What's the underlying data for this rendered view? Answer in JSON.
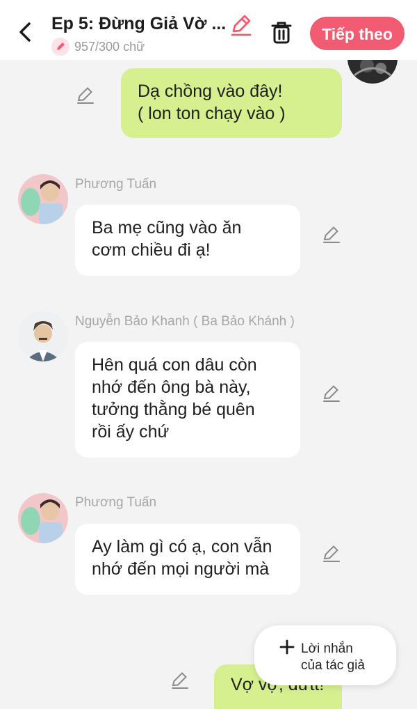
{
  "header": {
    "title": "Ep 5: Đừng Giả Vờ ...",
    "word_count": "957/300 chữ",
    "next_label": "Tiếp theo"
  },
  "messages": [
    {
      "side": "me",
      "text": "Dạ chồng vào đây!\n( lon ton chạy vào )"
    },
    {
      "side": "other",
      "name": "Phương Tuấn",
      "text": "Ba mẹ cũng vào ăn\ncơm chiều đi ạ!"
    },
    {
      "side": "other",
      "name": "Nguyễn Bảo Khanh ( Ba Bảo Khánh )",
      "text": "Hên quá con dâu còn\nnhớ đến ông bà này,\ntưởng thằng bé quên\nrồi ấy chứ"
    },
    {
      "side": "other",
      "name": "Phương Tuấn",
      "text": "Ay làm gì có ạ, con vẫn\nnhớ đến mọi người mà"
    },
    {
      "side": "me",
      "text": "Vợ vợ, đưtt!"
    }
  ],
  "author_note_button": {
    "label": "Lời nhắn\ncủa tác giả"
  },
  "colors": {
    "accent": "#f25c72",
    "my_bubble": "#d6f08f",
    "other_bubble": "#ffffff",
    "background": "#f3f3f3"
  },
  "icons": [
    "back-arrow-icon",
    "pencil-icon",
    "trash-icon",
    "plus-icon"
  ]
}
